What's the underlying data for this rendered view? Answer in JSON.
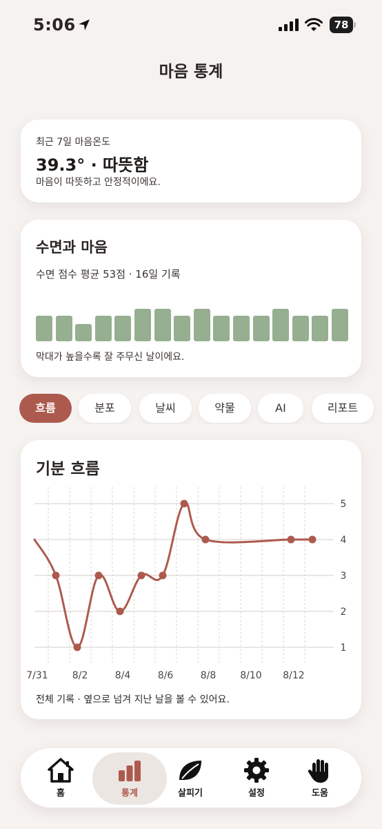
{
  "status": {
    "time": "5:06",
    "battery": "78"
  },
  "page": {
    "title": "마음 통계"
  },
  "temperature": {
    "label": "최근 7일 마음온도",
    "value": "39.3° · 따뜻함",
    "description": "마음이 따뜻하고 안정적이에요."
  },
  "sleep": {
    "title": "수면과 마음",
    "summary": "수면 점수 평균 53점 · 16일 기록",
    "bars": [
      0.66,
      0.66,
      0.44,
      0.66,
      0.66,
      0.84,
      0.84,
      0.66,
      0.84,
      0.66,
      0.66,
      0.66,
      0.84,
      0.66,
      0.66,
      0.84
    ],
    "note": "막대가 높을수록 잘 주무신 날이에요.",
    "bar_color": "#95af90"
  },
  "filters": [
    "흐름",
    "분포",
    "날씨",
    "약물",
    "AI",
    "리포트"
  ],
  "filter_active": "흐름",
  "mood": {
    "title": "기분 흐름",
    "footer": "전체 기록 · 옆으로 넘겨 지난 날을 볼 수 있어요."
  },
  "chart_data": {
    "type": "line",
    "title": "기분 흐름",
    "x_labels": [
      "7/31",
      "8/2",
      "8/4",
      "8/6",
      "8/8",
      "8/10",
      "8/12"
    ],
    "points": [
      {
        "x": "7/31",
        "y": 4
      },
      {
        "x": "8/1",
        "y": 3
      },
      {
        "x": "8/2",
        "y": 1
      },
      {
        "x": "8/3",
        "y": 3
      },
      {
        "x": "8/4",
        "y": 2
      },
      {
        "x": "8/5",
        "y": 3
      },
      {
        "x": "8/6",
        "y": 3
      },
      {
        "x": "8/7",
        "y": 5
      },
      {
        "x": "8/8",
        "y": 4
      },
      {
        "x": "8/12",
        "y": 4
      },
      {
        "x": "8/13",
        "y": 4
      }
    ],
    "y_ticks": [
      1,
      2,
      3,
      4,
      5
    ],
    "ylim": [
      1,
      5
    ],
    "line_color": "#ad5a4e",
    "grid": true
  },
  "nav": {
    "items": [
      {
        "label": "홈",
        "icon": "home-icon"
      },
      {
        "label": "통계",
        "icon": "chart-icon"
      },
      {
        "label": "살피기",
        "icon": "leaf-icon"
      },
      {
        "label": "설정",
        "icon": "gear-icon"
      },
      {
        "label": "도움",
        "icon": "hand-icon"
      }
    ],
    "active": "통계"
  }
}
